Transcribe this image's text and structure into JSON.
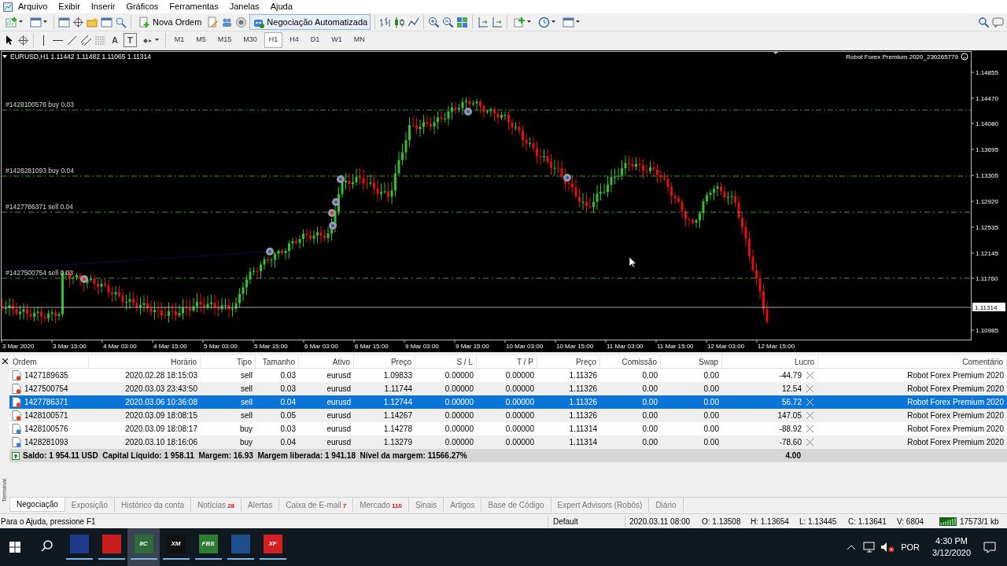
{
  "menu": [
    "Arquivo",
    "Exibir",
    "Inserir",
    "Gráficos",
    "Ferramentas",
    "Janelas",
    "Ajuda"
  ],
  "toolbar": {
    "buttons": [
      {
        "label": "Nova Ordem",
        "on": false
      },
      {
        "label": "Negociação Automatizada",
        "on": true
      }
    ],
    "drawing_tools": [
      "A",
      "T"
    ],
    "timeframes": [
      {
        "label": "M1",
        "selected": false
      },
      {
        "label": "M5",
        "selected": false
      },
      {
        "label": "M15",
        "selected": false
      },
      {
        "label": "M30",
        "selected": false
      },
      {
        "label": "H1",
        "selected": true
      },
      {
        "label": "H4",
        "selected": false
      },
      {
        "label": "D1",
        "selected": false
      },
      {
        "label": "W1",
        "selected": false
      },
      {
        "label": "MN",
        "selected": false
      }
    ]
  },
  "chart": {
    "symbol_info": "EURUSD,H1  1.11442 1.11482 1.11065 1.11314",
    "expert": "Robot Forex Premium 2020_230265779",
    "price_labels": [
      "1.14855",
      "1.14470",
      "1.14080",
      "1.13695",
      "1.13305",
      "1.12920",
      "1.12535",
      "1.12145",
      "1.11760",
      "1.10985"
    ],
    "current_price": "1.11314",
    "time_labels": [
      "3 Mar 2020",
      "3 Mar 15:00",
      "4 Mar 03:00",
      "4 Mar 15:00",
      "5 Mar 03:00",
      "5 Mar 15:00",
      "6 Mar 03:00",
      "6 Mar 15:00",
      "9 Mar 03:00",
      "9 Mar 15:00",
      "10 Mar 03:00",
      "10 Mar 15:00",
      "11 Mar 03:00",
      "11 Mar 15:00",
      "12 Mar 03:00",
      "12 Mar 15:00"
    ],
    "order_lines": [
      {
        "label": "#1428100576 buy 0.03",
        "kind": "buy"
      },
      {
        "label": "#1428281093 buy 0.04",
        "kind": "buy"
      },
      {
        "label": "#1427786371 sell 0.04",
        "kind": "sell"
      },
      {
        "label": "#1427500754 sell 0.03",
        "kind": "sell"
      }
    ]
  },
  "terminal": {
    "columns": [
      "Ordem",
      "Horário",
      "Tipo",
      "Tamanho",
      "Ativo",
      "Preço",
      "S / L",
      "T / P",
      "Preço",
      "Comissão",
      "Swap",
      "Lucro",
      "Comentário"
    ],
    "rows": [
      {
        "kind": "sell",
        "selected": false,
        "cells": [
          "1427189635",
          "2020.02.28 18:15:03",
          "sell",
          "0.03",
          "eurusd",
          "1.09833",
          "0.00000",
          "0.00000",
          "1.11326",
          "0.00",
          "0.00",
          "-44.79",
          "Robot Forex Premium 2020"
        ]
      },
      {
        "kind": "sell",
        "selected": false,
        "cells": [
          "1427500754",
          "2020.03.03 23:43:50",
          "sell",
          "0.03",
          "eurusd",
          "1.11744",
          "0.00000",
          "0.00000",
          "1.11326",
          "0.00",
          "0.00",
          "12.54",
          "Robot Forex Premium 2020"
        ]
      },
      {
        "kind": "sell",
        "selected": true,
        "cells": [
          "1427786371",
          "2020.03.06 10:36:08",
          "sell",
          "0.04",
          "eurusd",
          "1.12744",
          "0.00000",
          "0.00000",
          "1.11326",
          "0.00",
          "0.00",
          "56.72",
          "Robot Forex Premium 2020"
        ]
      },
      {
        "kind": "sell",
        "selected": false,
        "cells": [
          "1428100571",
          "2020.03.09 18:08:15",
          "sell",
          "0.05",
          "eurusd",
          "1.14267",
          "0.00000",
          "0.00000",
          "1.11326",
          "0.00",
          "0.00",
          "147.05",
          "Robot Forex Premium 2020"
        ]
      },
      {
        "kind": "buy",
        "selected": false,
        "cells": [
          "1428100576",
          "2020.03.09 18:08:17",
          "buy",
          "0.03",
          "eurusd",
          "1.14278",
          "0.00000",
          "0.00000",
          "1.11314",
          "0.00",
          "0.00",
          "-88.92",
          "Robot Forex Premium 2020"
        ]
      },
      {
        "kind": "buy",
        "selected": false,
        "cells": [
          "1428281093",
          "2020.03.10 18:16:06",
          "buy",
          "0.04",
          "eurusd",
          "1.13279",
          "0.00000",
          "0.00000",
          "1.11314",
          "0.00",
          "0.00",
          "-78.60",
          "Robot Forex Premium 2020"
        ]
      }
    ],
    "summary": "Saldo: 1 954.11 USD  Capital Líquido: 1 958.11  Margem: 16.93  Margem liberada: 1 941.18  Nível da margem: 11566.27%",
    "total": "4.00",
    "side_label": "Terminal",
    "tabs": [
      {
        "label": "Negociação",
        "selected": true
      },
      {
        "label": "Exposição",
        "selected": false
      },
      {
        "label": "Histórico da conta",
        "selected": false
      },
      {
        "label": "Notícias",
        "badge": "28",
        "selected": false
      },
      {
        "label": "Alertas",
        "selected": false
      },
      {
        "label": "Caixa de E-mail",
        "badge": "7",
        "selected": false
      },
      {
        "label": "Mercado",
        "badge": "110",
        "selected": false
      },
      {
        "label": "Sinais",
        "selected": false
      },
      {
        "label": "Artigos",
        "selected": false
      },
      {
        "label": "Base de Código",
        "selected": false
      },
      {
        "label": "Expert Advisors (Robôs)",
        "selected": false
      },
      {
        "label": "Diário",
        "selected": false
      }
    ]
  },
  "status_bar": {
    "help": "Para o Ajuda, pressione F1",
    "profile": "Default",
    "time": "2020.03.11 08:00",
    "open": "O: 1.13508",
    "high": "H: 1.13654",
    "low": "L: 1.13445",
    "close": "C: 1.13641",
    "volume": "V: 6804",
    "traffic": "17573/1 kb"
  },
  "taskbar": {
    "apps": [
      {
        "color": "#1e3a8a",
        "selected": false
      },
      {
        "color": "#c81e1e",
        "selected": false
      },
      {
        "label": "IIC",
        "color": "#2f6b3a",
        "selected": true
      },
      {
        "label": "XM",
        "color": "#111111",
        "selected": false
      },
      {
        "label": "FBS",
        "color": "#2e7d32",
        "selected": false
      },
      {
        "color": "#1f4e8c",
        "selected": false
      },
      {
        "label": "XF",
        "color": "#d32020",
        "selected": false
      }
    ],
    "language": "POR",
    "clock": "4:30 PM",
    "date": "3/12/2020"
  }
}
